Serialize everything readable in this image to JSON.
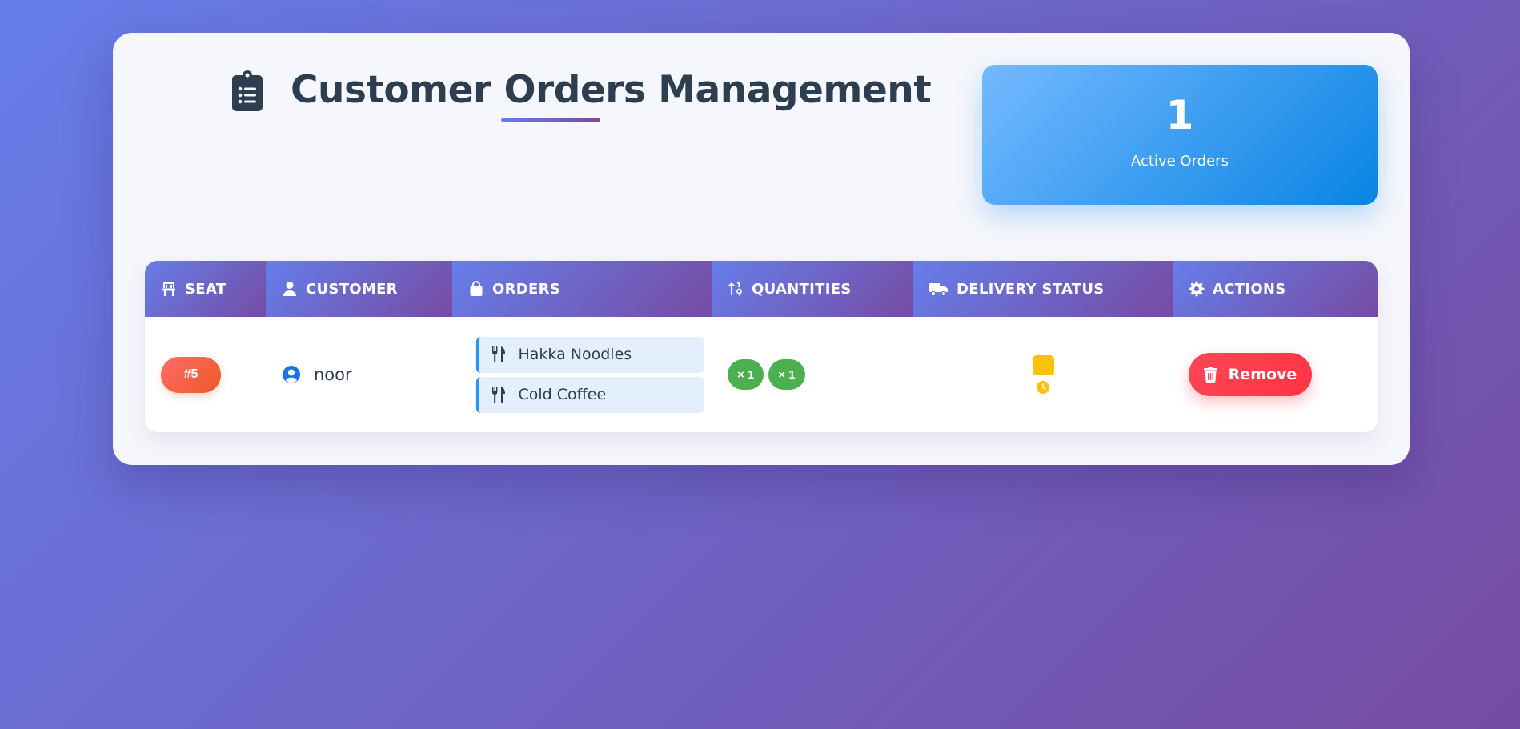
{
  "header": {
    "title": "Customer Orders Management",
    "title_icon": "clipboard-list-icon"
  },
  "stats": {
    "active_orders_count": "1",
    "active_orders_label": "Active Orders"
  },
  "table": {
    "columns": [
      {
        "label": "SEAT",
        "icon": "chair-icon"
      },
      {
        "label": "CUSTOMER",
        "icon": "user-icon"
      },
      {
        "label": "ORDERS",
        "icon": "shopping-bag-icon"
      },
      {
        "label": "QUANTITIES",
        "icon": "sort-numeric-icon"
      },
      {
        "label": "DELIVERY STATUS",
        "icon": "truck-icon"
      },
      {
        "label": "ACTIONS",
        "icon": "gear-icon"
      }
    ],
    "rows": [
      {
        "seat": "#5",
        "customer": "noor",
        "orders": [
          "Hakka Noodles",
          "Cold Coffee"
        ],
        "quantities": [
          "× 1",
          "× 1"
        ],
        "status": "pending",
        "action_label": "Remove"
      }
    ]
  },
  "colors": {
    "background_gradient": [
      "#667eea",
      "#764ba2"
    ],
    "stat_gradient": [
      "#74b9ff",
      "#0984e3"
    ],
    "seat_badge": "#ff6b6b",
    "quantity_badge": "#4caf50",
    "status_pending": "#ffc107",
    "remove_button": "#ff4757",
    "title_text": "#2c3e50"
  }
}
